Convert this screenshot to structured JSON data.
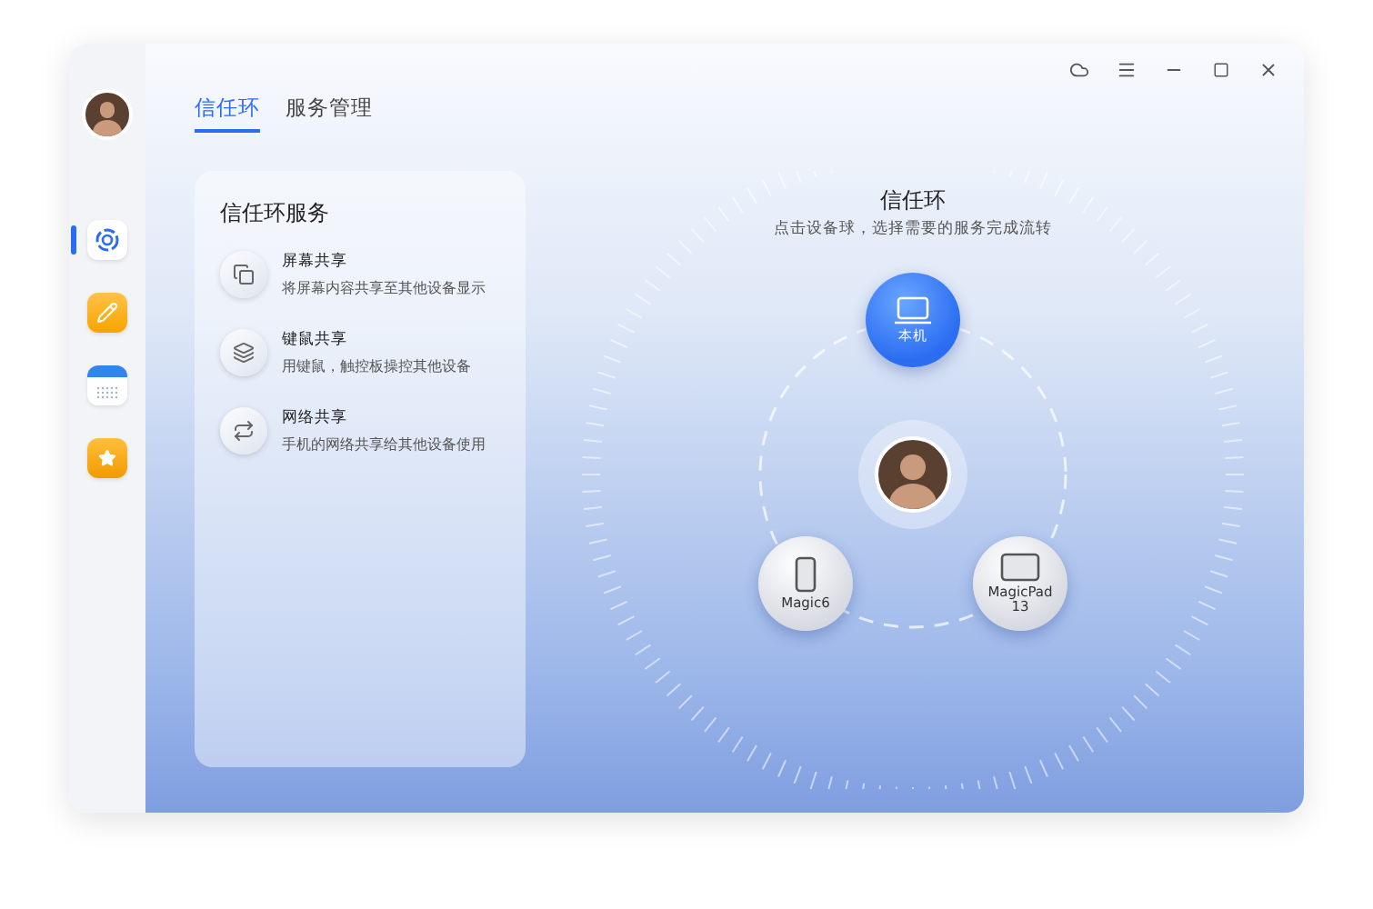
{
  "sidebar": {
    "items": [
      {
        "kind": "ring",
        "selected": true
      },
      {
        "kind": "notes",
        "selected": false
      },
      {
        "kind": "calendar",
        "selected": false
      },
      {
        "kind": "star",
        "selected": false
      }
    ]
  },
  "tabs": [
    {
      "label": "信任环",
      "selected": true
    },
    {
      "label": "服务管理",
      "selected": false
    }
  ],
  "services": {
    "title": "信任环服务",
    "items": [
      {
        "kind": "screen",
        "name": "屏幕共享",
        "desc": "将屏幕内容共享至其他设备显示"
      },
      {
        "kind": "keyboard",
        "name": "键鼠共享",
        "desc": "用键鼠，触控板操控其他设备"
      },
      {
        "kind": "network",
        "name": "网络共享",
        "desc": "手机的网络共享给其他设备使用"
      }
    ]
  },
  "ring": {
    "title": "信任环",
    "subtitle": "点击设备球，选择需要的服务完成流转",
    "devices": [
      {
        "kind": "laptop",
        "label": "本机",
        "selected": true
      },
      {
        "kind": "phone",
        "label": "Magic6",
        "selected": false
      },
      {
        "kind": "tablet",
        "label": "MagicPad 13",
        "selected": false
      }
    ]
  }
}
